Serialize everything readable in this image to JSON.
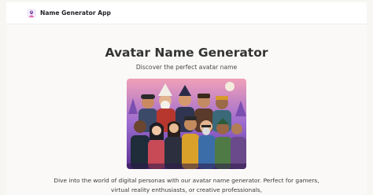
{
  "navbar": {
    "brand": "Name Generator App",
    "logo_icon": "avatar-logo-icon"
  },
  "main": {
    "title": "Avatar Name Generator",
    "subtitle": "Discover the perfect avatar name",
    "hero_image": "illustrated-avatar-group",
    "description": "Dive into the world of digital personas with our avatar name generator. Perfect for gamers, virtual reality enthusiasts, or creative professionals,"
  },
  "colors": {
    "background": "#f7f6f3",
    "header": "#ffffff",
    "text": "#333333"
  }
}
